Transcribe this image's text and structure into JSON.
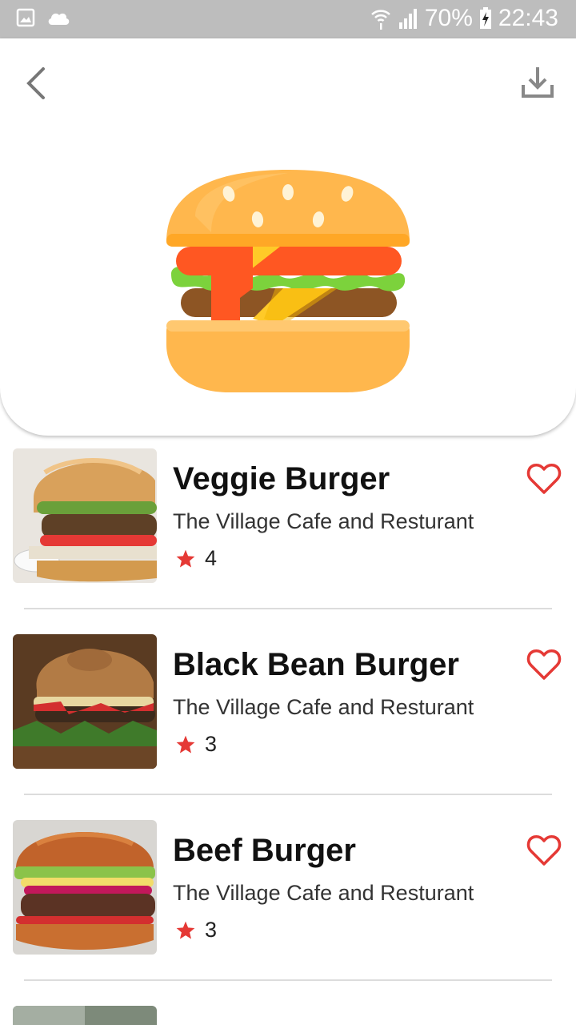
{
  "status_bar": {
    "battery": "70%",
    "time": "22:43",
    "icons": [
      "gallery-icon",
      "cloud-icon",
      "wifi-icon",
      "signal-icon",
      "battery-charging-icon"
    ]
  },
  "header": {
    "back_icon": "chevron-left-icon",
    "download_icon": "download-icon",
    "hero_icon": "burger-icon"
  },
  "colors": {
    "accent_red": "#e53935",
    "star": "#e53935",
    "bun": "#ffb74d",
    "lettuce": "#7cd23c",
    "cheese": "#ffca28"
  },
  "items": [
    {
      "title": "Veggie Burger",
      "subtitle": "The Village Cafe and Resturant",
      "rating": "4"
    },
    {
      "title": "Black Bean Burger",
      "subtitle": "The Village Cafe and Resturant",
      "rating": "3"
    },
    {
      "title": "Beef Burger",
      "subtitle": "The Village Cafe and Resturant",
      "rating": "3"
    }
  ]
}
